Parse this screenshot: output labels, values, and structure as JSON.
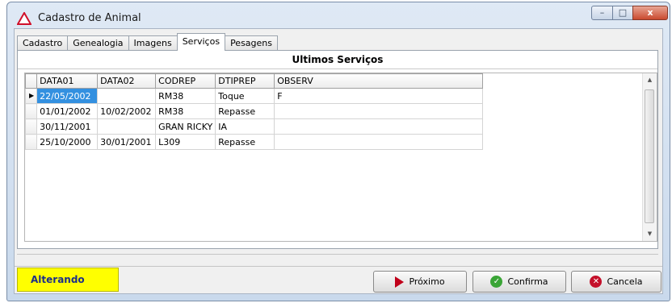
{
  "window": {
    "title": "Cadastro de Animal"
  },
  "tabs": [
    {
      "label": "Cadastro",
      "active": false
    },
    {
      "label": "Genealogia",
      "active": false
    },
    {
      "label": "Imagens",
      "active": false
    },
    {
      "label": "Serviços",
      "active": true
    },
    {
      "label": "Pesagens",
      "active": false
    }
  ],
  "panel": {
    "title": "Ultimos Serviços"
  },
  "grid": {
    "columns": [
      "DATA01",
      "DATA02",
      "CODREP",
      "DTIPREP",
      "OBSERV"
    ],
    "rows": [
      [
        "22/05/2002",
        "",
        "RM38",
        "Toque",
        "F"
      ],
      [
        "01/01/2002",
        "10/02/2002",
        "RM38",
        "Repasse",
        ""
      ],
      [
        "30/11/2001",
        "",
        "GRAN RICKY",
        "IA",
        ""
      ],
      [
        "25/10/2000",
        "30/01/2001",
        "L309",
        "Repasse",
        ""
      ]
    ],
    "selected_row": 0
  },
  "footer": {
    "mode_label": "Alterando",
    "next_label": "Próximo",
    "confirm_label": "Confirma",
    "cancel_label": "Cancela"
  },
  "colors": {
    "mode_bg": "#ffff00",
    "selection": "#3390e0",
    "confirm_icon": "#3aa536",
    "cancel_icon": "#c4102a",
    "next_icon": "#c0001a"
  },
  "icons": {
    "app": "warning-triangle-icon",
    "next": "play-arrow-icon",
    "confirm": "check-circle-icon",
    "cancel": "x-circle-icon"
  }
}
